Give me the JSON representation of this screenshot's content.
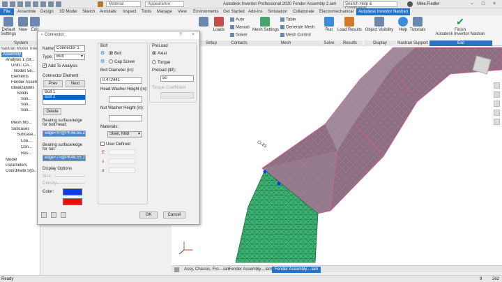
{
  "titlebar": {
    "material_placeholder": "Material",
    "appearance_placeholder": "Appearance",
    "title": "Autodesk Inventor Professional 2020   Fender Assembly 2.iam",
    "search": "Search Help & Commands...",
    "user": "Mike.Fiedler",
    "controls": [
      "–",
      "□",
      "×"
    ]
  },
  "tabs": [
    "File",
    "Assemble",
    "Design",
    "3D Model",
    "Sketch",
    "Annotate",
    "Inspect",
    "Tools",
    "Manage",
    "View",
    "Environments",
    "Get Started",
    "Add-Ins",
    "Simulation",
    "Collaborate",
    "Electromechanical",
    "Autodesk Inventor Nastran"
  ],
  "ribbon": {
    "default_settings": "Default\nSettings",
    "new": "New",
    "edit": "Edit",
    "system_label": "System",
    "loads": "Loads",
    "setup_label": "Setup",
    "contacts_auto": "Auto",
    "contacts_manual": "Manual",
    "contacts_solver": "Solver",
    "contacts_label": "Contacts",
    "mesh_settings": "Mesh Settings",
    "mesh_table": "Table",
    "mesh_generate": "Generate Mesh",
    "mesh_control": "Mesh Control",
    "mesh_label": "Mesh",
    "run": "Run",
    "solve_label": "Solve",
    "load_results": "Load Results",
    "results_label": "Results",
    "object_visibility": "Object Visibility",
    "display_label": "Display",
    "help": "Help",
    "tutorials": "Tutorials",
    "support_label": "Nastran Support",
    "finish": "Finish\nAutodesk Inventor Nastran",
    "exit_label": "Exit"
  },
  "browser": {
    "title": "Nastran Model Tree",
    "items": [
      "Assembly",
      "Analysis 1 (St...",
      "Units: CA...",
      "Nodes 56...",
      "Elements",
      "Fender Assembly...",
      "Idealizations",
      "Solids",
      "Soli...",
      "Soli...",
      "Soli...",
      "Mesh Mo...",
      "Subcases",
      "Subcase...",
      "Loa...",
      "Con...",
      "Res...",
      "Model",
      "Parameters",
      "Coordinate Sys..."
    ]
  },
  "dialog": {
    "title": "Connector",
    "name_label": "Name:",
    "name_value": "Connector 1",
    "type_label": "Type:",
    "type_value": "Bolt",
    "add_to_analysis": "Add To Analysis",
    "connector_element_label": "Connector Element",
    "prev": "Prev",
    "next": "Next",
    "list_items": [
      "Bolt 1",
      "Bolt 2"
    ],
    "delete": "Delete",
    "bearing_head_label": "Bearing surface/edge for bolt head:",
    "bearing_head_value": "edge<4>@PK46.55.26.062",
    "bearing_nut_label": "Bearing surface/edge for nut:",
    "bearing_nut_value": "edge<7>@PK46.55.26.084",
    "display_options_label": "Display Options",
    "size_label": "Size:",
    "density_label": "Density:",
    "color_label": "Color:",
    "color_1": "#0a3de6",
    "color_2": "#e61010",
    "bolt_group_label": "Bolt",
    "bolt_radio": "Bolt",
    "cap_screw_radio": "Cap Screw",
    "bolt_diameter_label": "Bolt Diameter (in):",
    "bolt_diameter_value": "0.472441",
    "head_washer_label": "Head Washer Height (in):",
    "nut_washer_label": "Nut Washer Height (in):",
    "materials_label": "Materials:",
    "materials_value": "Steel, Mild",
    "user_defined": "User Defined",
    "prop_e": "E",
    "prop_nu": "ν",
    "prop_alpha": "α",
    "preload_group_label": "PreLoad",
    "axial": "Axial",
    "torque": "Torque",
    "preload_label": "Preload (lbf):",
    "preload_value": "50",
    "torque_coeff_label": "Torque Coefficient",
    "ok": "OK",
    "cancel": "Cancel"
  },
  "viewport": {
    "annotation": "Ct-81",
    "mesh_color": "#3cb371",
    "part_color": "#8d6e80",
    "edge_color": "#e0559b"
  },
  "doc_tabs": [
    "Assy, Chassis, Fro....iam",
    "Fender Assembly....iam",
    "Fender Assembly....iam"
  ],
  "status": {
    "left": "Ready",
    "right_a": "9",
    "right_b": "262"
  }
}
